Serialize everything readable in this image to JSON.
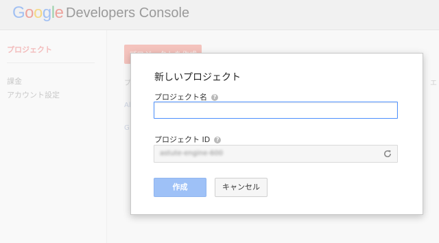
{
  "header": {
    "logo_letters": [
      {
        "char": "G",
        "color": "#4285f4"
      },
      {
        "char": "o",
        "color": "#ea4335"
      },
      {
        "char": "o",
        "color": "#fbbc05"
      },
      {
        "char": "g",
        "color": "#4285f4"
      },
      {
        "char": "l",
        "color": "#34a853"
      },
      {
        "char": "e",
        "color": "#ea4335"
      }
    ],
    "title": "Developers Console"
  },
  "sidebar": {
    "items": [
      {
        "label": "プロジェクト",
        "active": true
      },
      {
        "label": "課金",
        "active": false
      },
      {
        "label": "アカウント設定",
        "active": false
      }
    ]
  },
  "background": {
    "create_button_label": "プロジェクトを作成",
    "column_header_left": "プ",
    "column_header_right": "エ",
    "row_1": "Al",
    "row_2": "G"
  },
  "dialog": {
    "title": "新しいプロジェクト",
    "name_label": "プロジェクト名",
    "name_value": "",
    "id_label": "プロジェクト ID",
    "id_value": "astute-engine-600",
    "help_icon": "?",
    "refresh_icon": "refresh-icon",
    "create_label": "作成",
    "cancel_label": "キャンセル"
  },
  "colors": {
    "primary_button": "#9ec1f7",
    "input_focus": "#4d90fe",
    "accent_red": "#dd4b39"
  }
}
